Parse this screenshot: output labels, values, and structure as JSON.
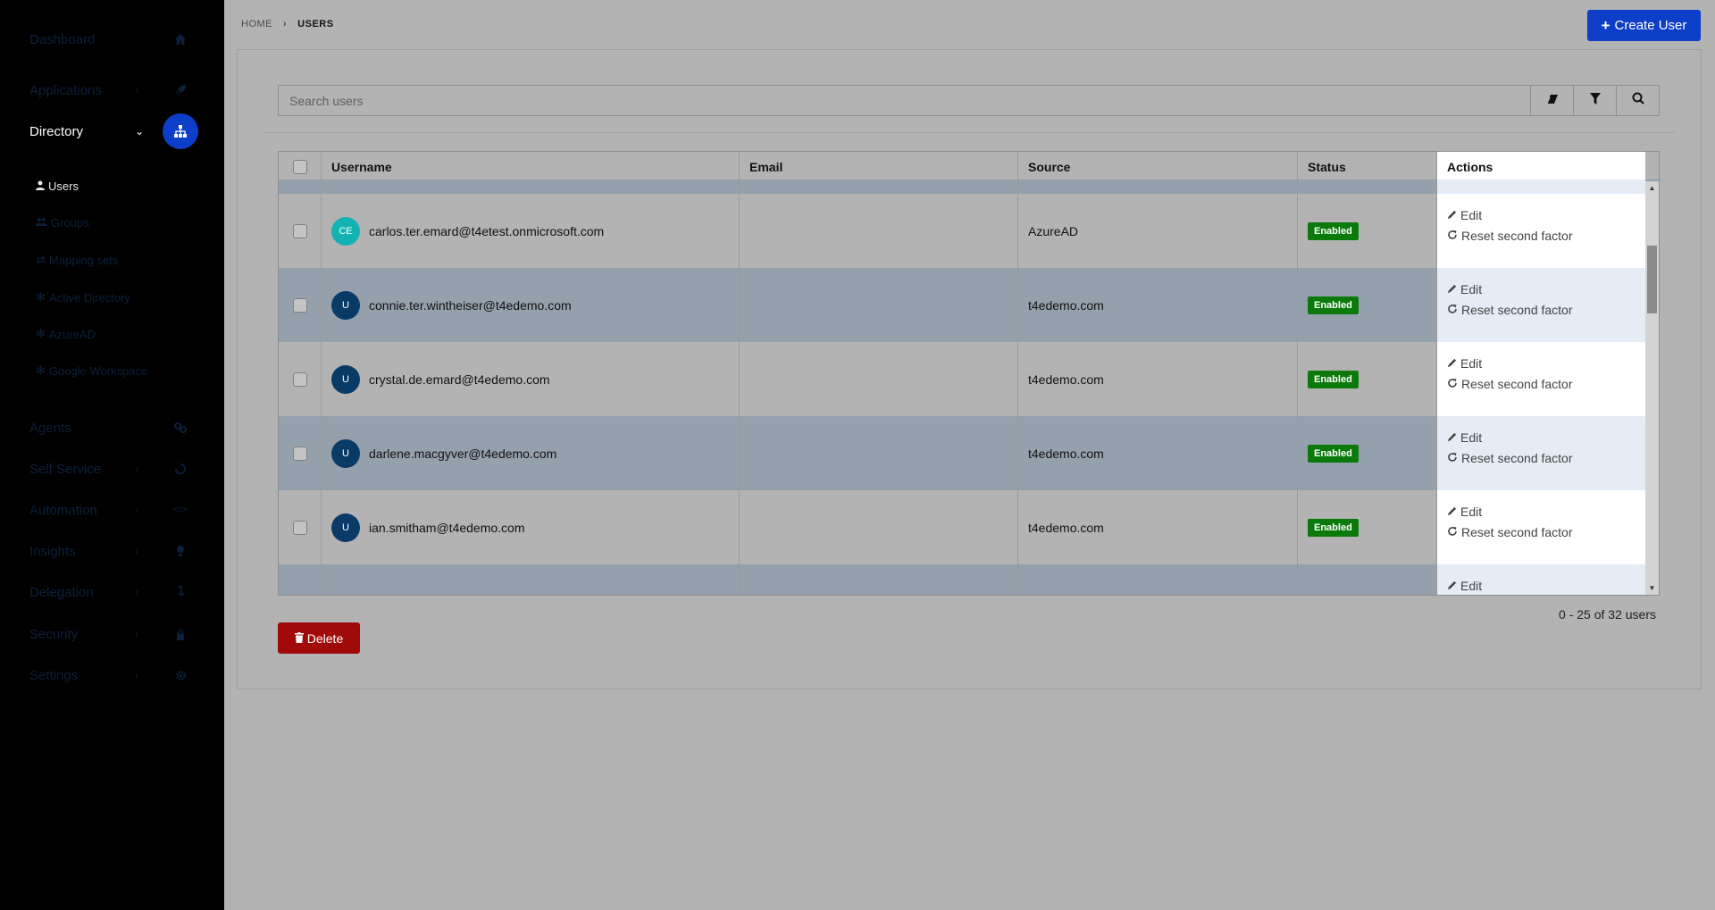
{
  "sidebar": {
    "items": [
      {
        "label": "Dashboard",
        "icon": "home-icon"
      },
      {
        "label": "Applications",
        "icon": "rocket-icon"
      },
      {
        "label": "Directory",
        "icon": "sitemap-icon"
      },
      {
        "label": "Agents",
        "icon": "agents-icon"
      },
      {
        "label": "Self Service",
        "icon": "hand-icon"
      },
      {
        "label": "Automation",
        "icon": "code-icon"
      },
      {
        "label": "Insights",
        "icon": "lightbulb-icon"
      },
      {
        "label": "Delegation",
        "icon": "delegation-icon"
      },
      {
        "label": "Security",
        "icon": "lock-icon"
      },
      {
        "label": "Settings",
        "icon": "gear-icon"
      }
    ],
    "directory_sub": [
      {
        "label": "Users",
        "icon": "user-icon"
      },
      {
        "label": "Groups",
        "icon": "users-icon"
      },
      {
        "label": "Mapping sets",
        "icon": "exchange-icon"
      },
      {
        "label": "Active Directory",
        "icon": "gear-icon"
      },
      {
        "label": "AzureAD",
        "icon": "gear-icon"
      },
      {
        "label": "Google Workspace",
        "icon": "gear-icon"
      }
    ]
  },
  "breadcrumb": {
    "home": "HOME",
    "current": "USERS"
  },
  "toolbar": {
    "create_label": "Create User",
    "delete_label": "Delete"
  },
  "search": {
    "placeholder": "Search users"
  },
  "table": {
    "columns": {
      "username": "Username",
      "email": "Email",
      "source": "Source",
      "status": "Status",
      "actions": "Actions"
    },
    "rows": [
      {
        "initials": "CE",
        "avatar_color": "#13b3b3",
        "username": "carlos.ter.emard@t4etest.onmicrosoft.com",
        "email": "",
        "source": "AzureAD",
        "status": "Enabled"
      },
      {
        "initials": "U",
        "avatar_color": "#0a3a66",
        "username": "connie.ter.wintheiser@t4edemo.com",
        "email": "",
        "source": "t4edemo.com",
        "status": "Enabled"
      },
      {
        "initials": "U",
        "avatar_color": "#0a3a66",
        "username": "crystal.de.emard@t4edemo.com",
        "email": "",
        "source": "t4edemo.com",
        "status": "Enabled"
      },
      {
        "initials": "U",
        "avatar_color": "#0a3a66",
        "username": "darlene.macgyver@t4edemo.com",
        "email": "",
        "source": "t4edemo.com",
        "status": "Enabled"
      },
      {
        "initials": "U",
        "avatar_color": "#0a3a66",
        "username": "ian.smitham@t4edemo.com",
        "email": "",
        "source": "t4edemo.com",
        "status": "Enabled"
      }
    ],
    "partial_row": {
      "avatar_color": "#1565c0",
      "status_color": "#0b7a0b"
    },
    "action_edit": "Edit",
    "action_reset": "Reset second factor"
  },
  "pagination": {
    "text": "0 - 25 of 32 users"
  },
  "colors": {
    "accent": "#0d3ec7",
    "danger": "#a10a0a",
    "enabled": "#0b7a0b"
  }
}
